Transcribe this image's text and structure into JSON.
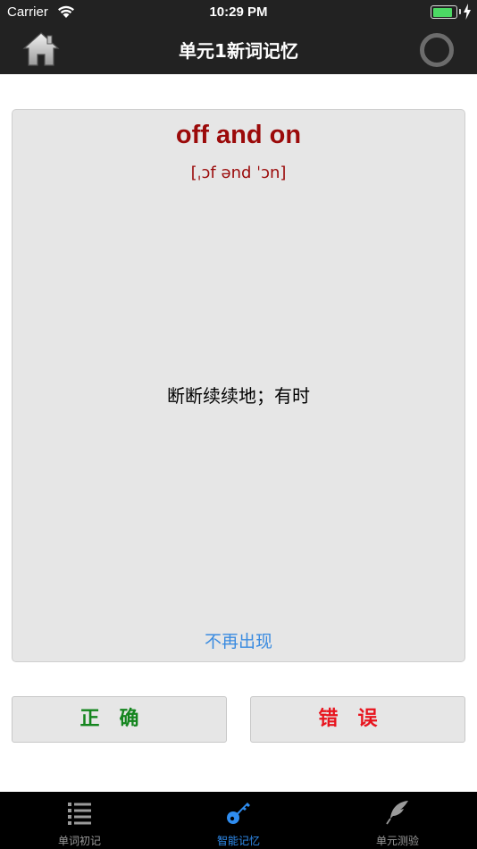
{
  "status_bar": {
    "carrier": "Carrier",
    "time": "10:29 PM",
    "battery_level": 0.9
  },
  "nav": {
    "title": "单元1新词记忆",
    "home_icon": "home-icon",
    "right_icon": "ring-icon"
  },
  "card": {
    "word": "off and on",
    "phonetic": "[ˌɔf ənd ˈɔn]",
    "meaning": "断断续续地；有时",
    "hide_link": "不再出现"
  },
  "buttons": {
    "correct": "正确",
    "wrong": "错误"
  },
  "tabs": [
    {
      "label": "单词初记",
      "icon": "list-icon",
      "active": false
    },
    {
      "label": "智能记忆",
      "icon": "key-icon",
      "active": true
    },
    {
      "label": "单元测验",
      "icon": "feather-icon",
      "active": false
    }
  ],
  "colors": {
    "bar_bg": "#222222",
    "card_bg": "#e6e6e6",
    "word": "#9b0a0a",
    "link": "#3a8be0",
    "correct": "#14851e",
    "wrong": "#e8141e",
    "tab_active": "#2f8df0",
    "tab_inactive": "#9a9a9a"
  }
}
